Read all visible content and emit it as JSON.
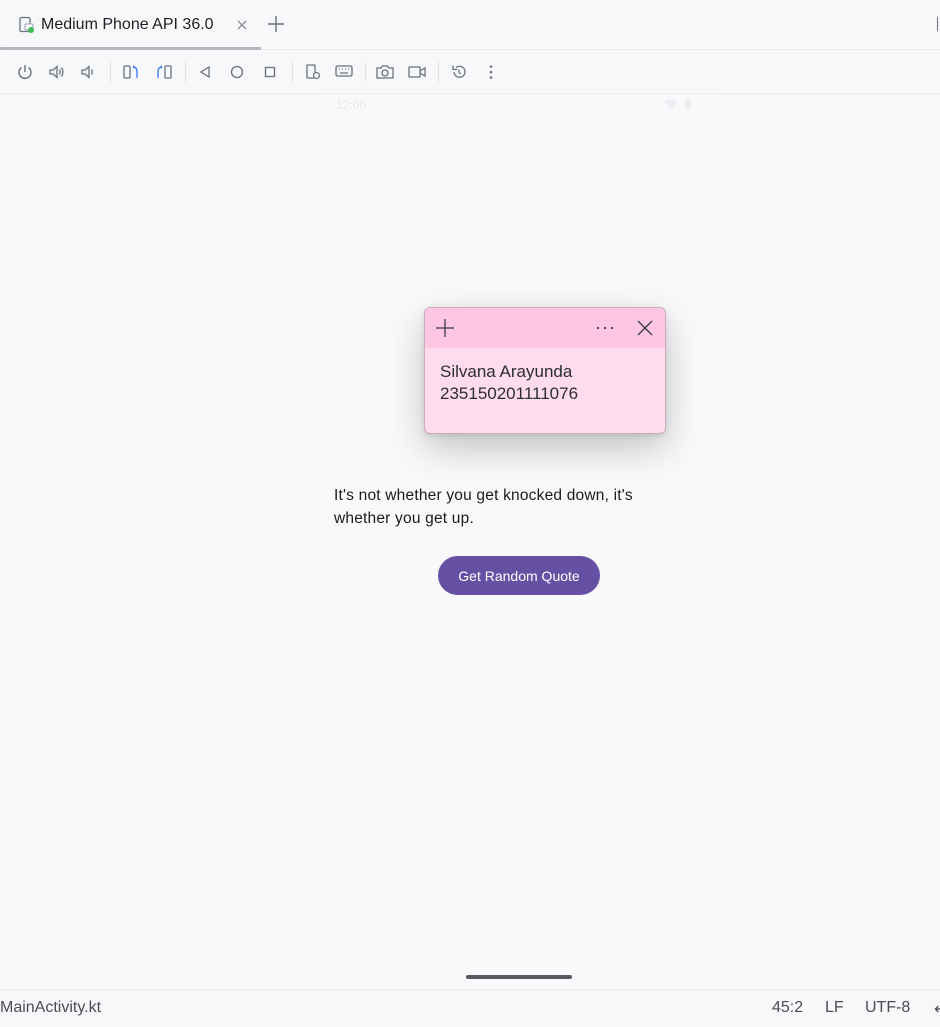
{
  "tab": {
    "title": "Medium Phone API 36.0",
    "close_icon": "close-icon",
    "add_icon": "plus-icon"
  },
  "toolbar": {
    "buttons": [
      "power-icon",
      "volume-up-icon",
      "volume-down-icon",
      "rotate-left-icon",
      "rotate-right-icon",
      "back-icon",
      "home-icon",
      "overview-icon",
      "extended-controls-icon",
      "keyboard-icon",
      "screenshot-icon",
      "screen-record-icon",
      "snapshot-restore-icon",
      "more-icon"
    ]
  },
  "phone": {
    "status_time": "12:00",
    "quote_text": "It's not whether you get knocked down, it's whether you get up.",
    "button_label": "Get Random Quote"
  },
  "sticky_note": {
    "line1": "Silvana Arayunda",
    "line2": "235150201111076",
    "colors": {
      "header": "#fec6e3",
      "body": "#fedcee"
    }
  },
  "statusbar": {
    "file": "MainActivity.kt",
    "position": "45:2",
    "line_ending": "LF",
    "encoding": "UTF-8",
    "more": "↵"
  },
  "colors": {
    "accent": "#6650a4",
    "background": "#f7f8fa"
  }
}
